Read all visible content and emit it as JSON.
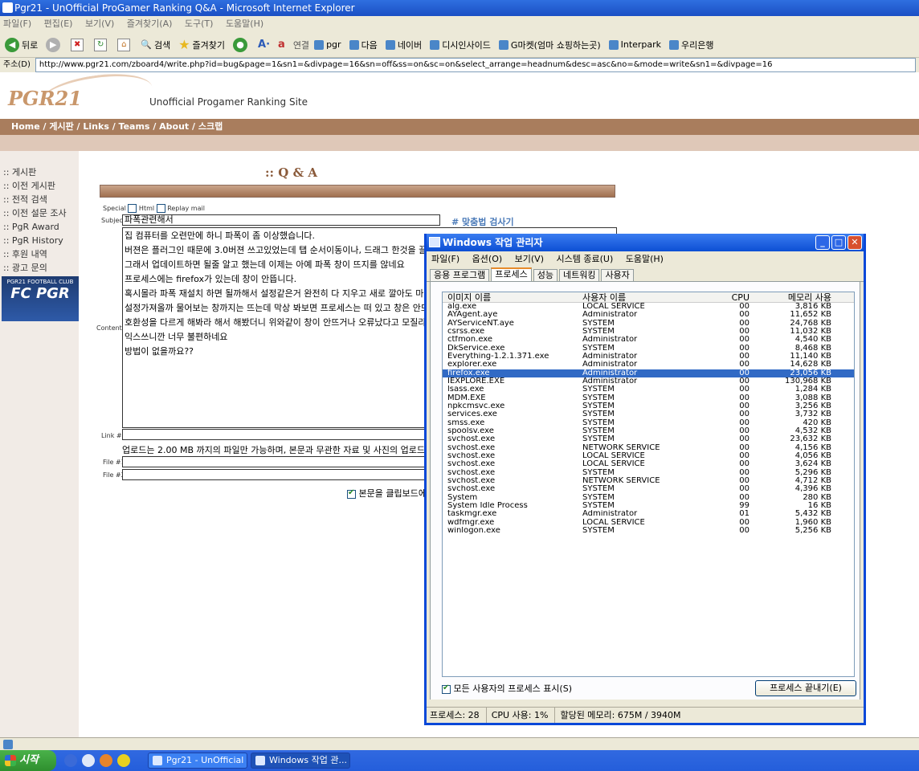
{
  "ie": {
    "title": "Pgr21 - UnOfficial ProGamer Ranking Q&A - Microsoft Internet Explorer",
    "menu": [
      "파일(F)",
      "편집(E)",
      "보기(V)",
      "즐겨찾기(A)",
      "도구(T)",
      "도움말(H)"
    ],
    "toolbar": {
      "back": "뒤로",
      "search": "검색",
      "favorites": "즐겨찾기",
      "links_label": "연결",
      "links": [
        "pgr",
        "다음",
        "네이버",
        "디시인사이드",
        "G마켓(엄마 쇼핑하는곳)",
        "Interpark",
        "우리은행"
      ]
    },
    "address_label": "주소(D)",
    "address": "http://www.pgr21.com/zboard4/write.php?id=bug&page=1&sn1=&divpage=16&sn=off&ss=on&sc=on&select_arrange=headnum&desc=asc&no=&mode=write&sn1=&divpage=16"
  },
  "site": {
    "logo": "PGR21",
    "tagline": "Unofficial Progamer Ranking Site",
    "nav": "Home / 게시판 / Links / Teams / About / 스크랩",
    "side_menu": [
      ":: 게시판",
      ":: 이전 게시판",
      ":: 전적 검색",
      ":: 이전 설문 조사",
      ":: PgR Award",
      ":: PgR History",
      ":: 후원 내역",
      ":: 광고 문의"
    ],
    "banner_small": "PGR21 FOOTBALL CLUB",
    "banner_big": "FC PGR"
  },
  "form": {
    "title": ":: Q & A",
    "special_label": "Special",
    "html_label": "Html",
    "replay_label": "Replay mail",
    "subject_label": "Subject",
    "subject_value": "파폭관련해서",
    "spell_check": "# 맞춤법 검사기",
    "contents_label": "Contents",
    "contents_lines": [
      "집 컴퓨터를 오련만에 하니 파폭이 좀 이상했습니다.",
      "버젼은 플러그인 때문에 3.0버젼 쓰고있었는데 탭 순서이동이나, 드래그 한것을 끌때 파",
      "그래서 업데이트하면 될줄 알고 했는데 이제는 아예 파폭 창이 뜨지를 않네요",
      "프로세스에는 firefox가 있는데 창이 안뜹니다.",
      "혹시몰라 파폭 재설치 하면 될까해서 설정같은거 완전히 다 지우고 새로 깔아도 마찬가지",
      "설정가져올까 물어보는 창까지는 뜨는데 막상 봐보면 프로세스는 떠 있고 창은 안뜨는 ",
      "호환성을 다르게 해봐라 해서 해봤더니 위와같이 창이 안뜨거나 오류났다고 모질라에 보",
      "익스쓰니깐 너무 불편하네요",
      "방법이 없을까요??"
    ],
    "link_label": "Link #1",
    "upload_note": "업로드는 2.00 MB 까지의 파일만 가능하며, 본문과 무관한 자료 및 사진의 업로드는 금지",
    "file1_label": "File #1",
    "file2_label": "File #2",
    "clipboard_label": "본문을 클립보드에"
  },
  "taskmgr": {
    "title": "Windows 작업 관리자",
    "menu": [
      "파일(F)",
      "옵션(O)",
      "보기(V)",
      "시스템 종료(U)",
      "도움말(H)"
    ],
    "tabs": [
      "응용 프로그램",
      "프로세스",
      "성능",
      "네트워킹",
      "사용자"
    ],
    "columns": {
      "name": "이미지 이름",
      "user": "사용자 이름",
      "cpu": "CPU",
      "mem": "메모리 사용"
    },
    "processes": [
      {
        "name": "alg.exe",
        "user": "LOCAL SERVICE",
        "cpu": "00",
        "mem": "3,816 KB"
      },
      {
        "name": "AYAgent.aye",
        "user": "Administrator",
        "cpu": "00",
        "mem": "11,652 KB"
      },
      {
        "name": "AYServiceNT.aye",
        "user": "SYSTEM",
        "cpu": "00",
        "mem": "24,768 KB"
      },
      {
        "name": "csrss.exe",
        "user": "SYSTEM",
        "cpu": "00",
        "mem": "11,032 KB"
      },
      {
        "name": "ctfmon.exe",
        "user": "Administrator",
        "cpu": "00",
        "mem": "4,540 KB"
      },
      {
        "name": "DkService.exe",
        "user": "SYSTEM",
        "cpu": "00",
        "mem": "8,468 KB"
      },
      {
        "name": "Everything-1.2.1.371.exe",
        "user": "Administrator",
        "cpu": "00",
        "mem": "11,140 KB"
      },
      {
        "name": "explorer.exe",
        "user": "Administrator",
        "cpu": "00",
        "mem": "14,628 KB"
      },
      {
        "name": "firefox.exe",
        "user": "Administrator",
        "cpu": "00",
        "mem": "23,056 KB"
      },
      {
        "name": "IEXPLORE.EXE",
        "user": "Administrator",
        "cpu": "00",
        "mem": "130,968 KB"
      },
      {
        "name": "lsass.exe",
        "user": "SYSTEM",
        "cpu": "00",
        "mem": "1,284 KB"
      },
      {
        "name": "MDM.EXE",
        "user": "SYSTEM",
        "cpu": "00",
        "mem": "3,088 KB"
      },
      {
        "name": "npkcmsvc.exe",
        "user": "SYSTEM",
        "cpu": "00",
        "mem": "3,256 KB"
      },
      {
        "name": "services.exe",
        "user": "SYSTEM",
        "cpu": "00",
        "mem": "3,732 KB"
      },
      {
        "name": "smss.exe",
        "user": "SYSTEM",
        "cpu": "00",
        "mem": "420 KB"
      },
      {
        "name": "spoolsv.exe",
        "user": "SYSTEM",
        "cpu": "00",
        "mem": "4,532 KB"
      },
      {
        "name": "svchost.exe",
        "user": "SYSTEM",
        "cpu": "00",
        "mem": "23,632 KB"
      },
      {
        "name": "svchost.exe",
        "user": "NETWORK SERVICE",
        "cpu": "00",
        "mem": "4,156 KB"
      },
      {
        "name": "svchost.exe",
        "user": "LOCAL SERVICE",
        "cpu": "00",
        "mem": "4,056 KB"
      },
      {
        "name": "svchost.exe",
        "user": "LOCAL SERVICE",
        "cpu": "00",
        "mem": "3,624 KB"
      },
      {
        "name": "svchost.exe",
        "user": "SYSTEM",
        "cpu": "00",
        "mem": "5,296 KB"
      },
      {
        "name": "svchost.exe",
        "user": "NETWORK SERVICE",
        "cpu": "00",
        "mem": "4,712 KB"
      },
      {
        "name": "svchost.exe",
        "user": "SYSTEM",
        "cpu": "00",
        "mem": "4,396 KB"
      },
      {
        "name": "System",
        "user": "SYSTEM",
        "cpu": "00",
        "mem": "280 KB"
      },
      {
        "name": "System Idle Process",
        "user": "SYSTEM",
        "cpu": "99",
        "mem": "16 KB"
      },
      {
        "name": "taskmgr.exe",
        "user": "Administrator",
        "cpu": "01",
        "mem": "5,432 KB"
      },
      {
        "name": "wdfmgr.exe",
        "user": "LOCAL SERVICE",
        "cpu": "00",
        "mem": "1,960 KB"
      },
      {
        "name": "winlogon.exe",
        "user": "SYSTEM",
        "cpu": "00",
        "mem": "5,256 KB"
      }
    ],
    "selected_index": 8,
    "show_all_label": "모든 사용자의 프로세스 표시(S)",
    "end_process_label": "프로세스 끝내기(E)",
    "status": {
      "processes": "프로세스: 28",
      "cpu": "CPU 사용: 1%",
      "memory": "할당된 메모리: 675M / 3940M"
    }
  },
  "taskbar": {
    "start": "시작",
    "tasks": [
      "Pgr21 - UnOfficial ...",
      "Windows 작업 관..."
    ]
  }
}
